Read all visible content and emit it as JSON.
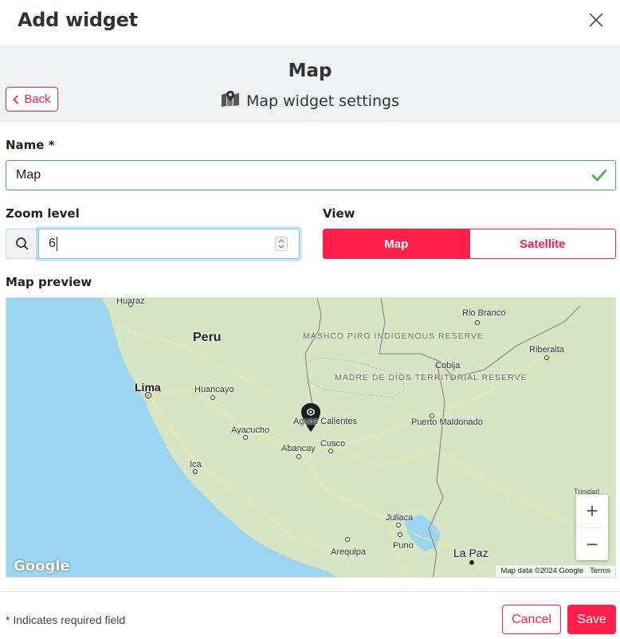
{
  "modal": {
    "title": "Add widget"
  },
  "widget": {
    "title": "Map",
    "subtitle": "Map widget settings",
    "back_label": "Back"
  },
  "form": {
    "name_label": "Name *",
    "name_value": "Map",
    "zoom_label": "Zoom level",
    "zoom_value": "6",
    "view_label": "View",
    "view_options": [
      "Map",
      "Satellite"
    ],
    "view_selected": "Map",
    "preview_label": "Map preview"
  },
  "map": {
    "countries": [
      "Peru"
    ],
    "cities": [
      "Lima",
      "Huancayo",
      "Ayacucho",
      "Aguas Calientes",
      "Cusco",
      "Abancay",
      "Ica",
      "Juliaca",
      "Puno",
      "Arequipa",
      "La Paz",
      "Puerto Maldonado",
      "Cobija",
      "Riberalta",
      "Rio Branco",
      "Huaraz",
      "Trinidad"
    ],
    "reserves": [
      "MASHCO PIRO INDIGENOUS RESERVE",
      "MADRE DE DIOS TERRITORIAL RESERVE"
    ],
    "zoom_in": "+",
    "zoom_out": "−",
    "logo": "Google",
    "attribution": "Map data ©2024 Google",
    "terms": "Terms"
  },
  "footer": {
    "note": "* Indicates required field",
    "cancel_label": "Cancel",
    "save_label": "Save"
  },
  "colors": {
    "accent": "#ff1f4b",
    "valid": "#4caf50",
    "water": "#9cd5ef",
    "land": "#d6e6c4"
  }
}
